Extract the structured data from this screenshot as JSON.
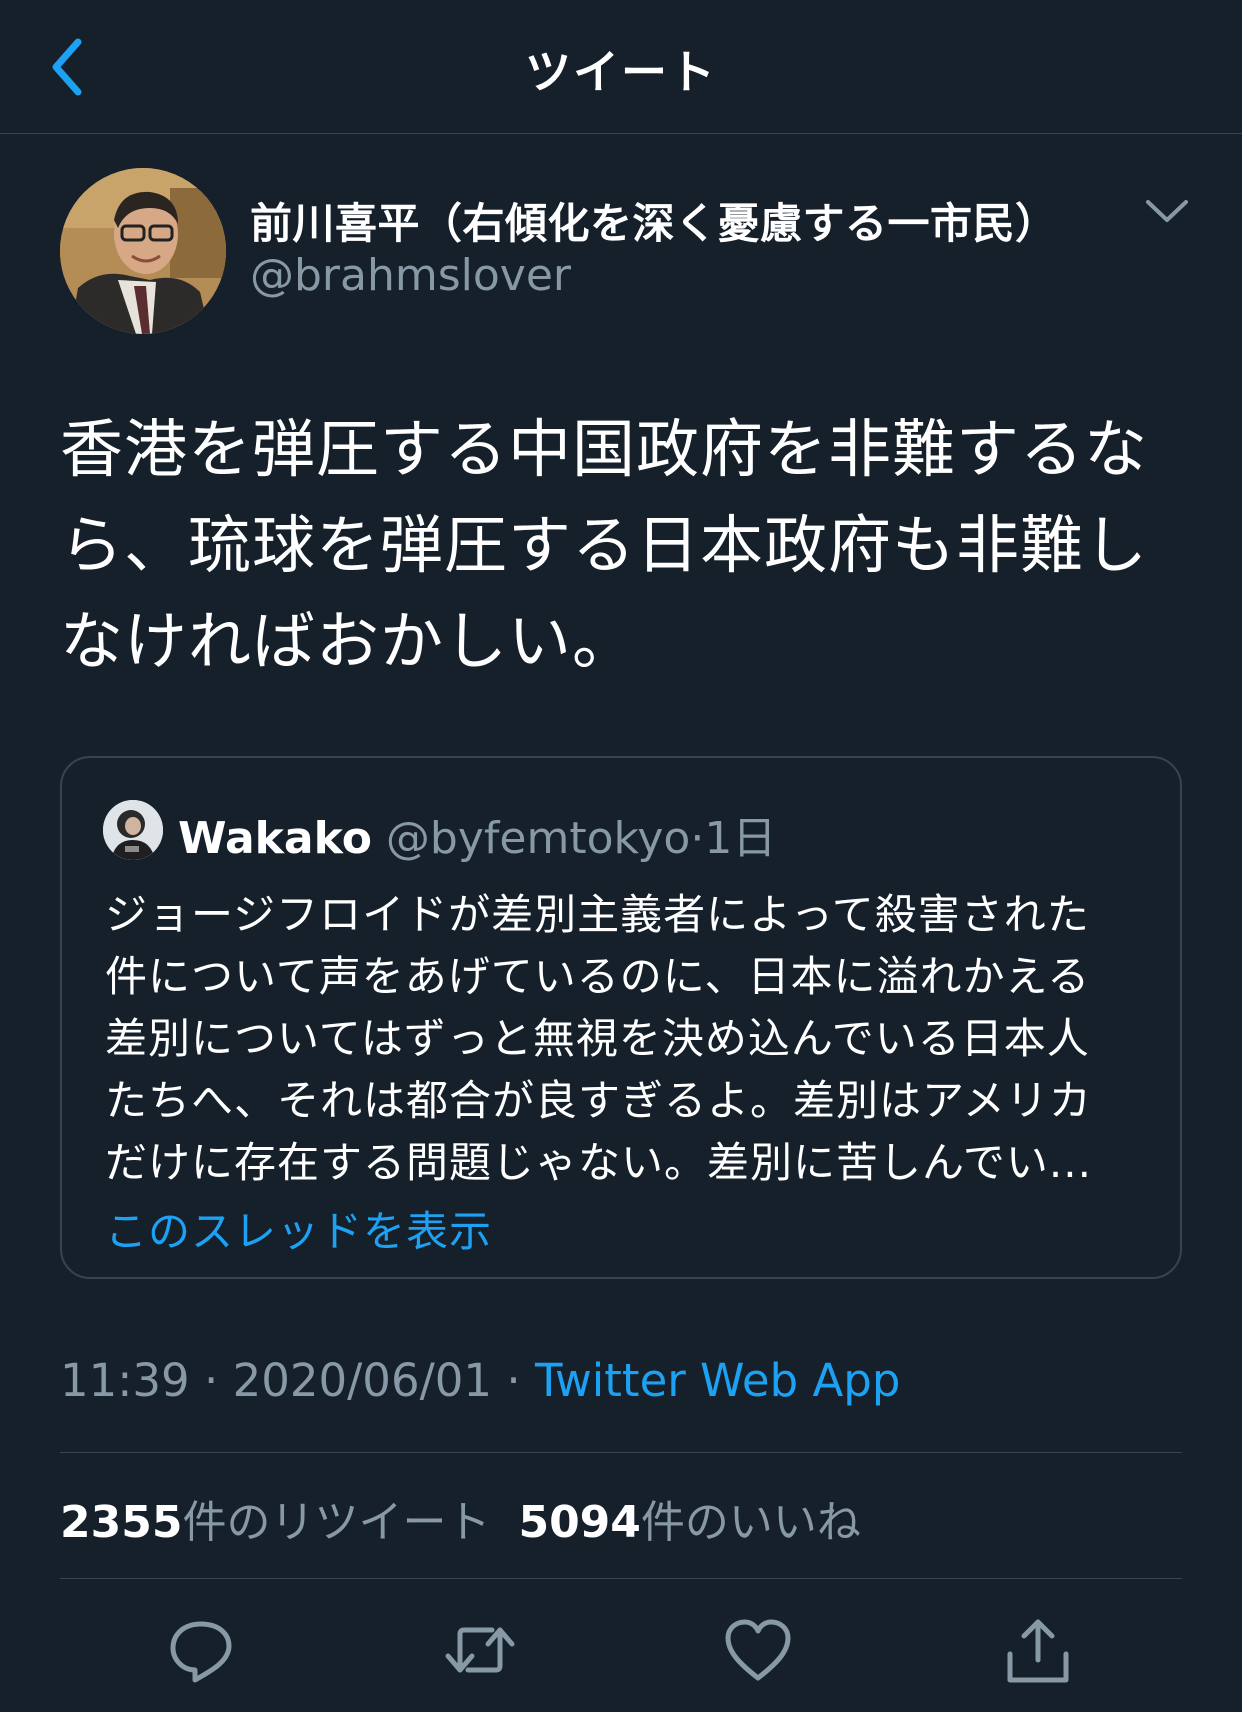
{
  "nav": {
    "title": "ツイート"
  },
  "tweet": {
    "display_name": "前川喜平（右傾化を深く憂慮する一市民）",
    "handle": "@brahmslover",
    "text_lines": [
      "香港を弾圧する中国政府を非難するな",
      "ら、琉球を弾圧する日本政府も非難し",
      "なければおかしい。"
    ],
    "time": "11:39",
    "date": "2020/06/01",
    "separator": "·",
    "source": "Twitter Web App"
  },
  "quote": {
    "name": "Wakako",
    "handle": "@byfemtokyo",
    "separator": "·",
    "time": "1日",
    "text_lines": [
      "ジョージフロイドが差別主義者によって殺害された",
      "件について声をあげているのに、日本に溢れかえる",
      "差別についてはずっと無視を決め込んでいる日本人",
      "たちへ、それは都合が良すぎるよ。差別はアメリカ",
      "だけに存在する問題じゃない。差別に苦しんでい..."
    ],
    "show_thread": "このスレッドを表示"
  },
  "stats": {
    "retweets_count": "2355",
    "retweets_label": "件のリツイート",
    "likes_count": "5094",
    "likes_label": "件のいいね"
  },
  "icons": {
    "back": "chevron-left-icon",
    "more": "chevron-down-icon",
    "reply": "reply-icon",
    "retweet": "retweet-icon",
    "like": "heart-icon",
    "share": "share-icon"
  },
  "colors": {
    "background": "#15202b",
    "accent": "#1da1f2",
    "secondary_text": "#8899a6",
    "border": "#38444d"
  }
}
